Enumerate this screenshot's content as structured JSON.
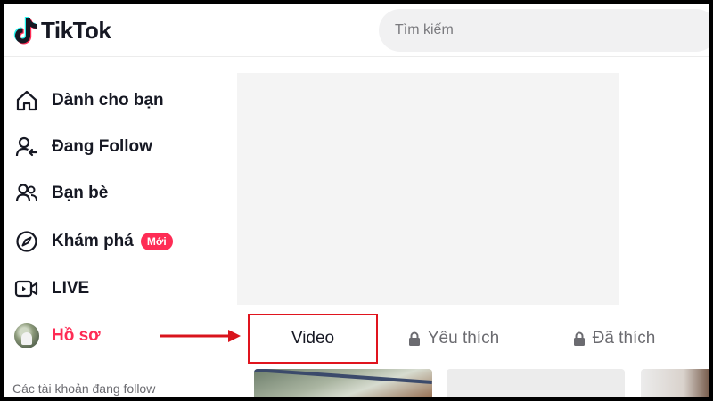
{
  "header": {
    "logo_text": "TikTok",
    "search": {
      "placeholder": "Tìm kiếm"
    }
  },
  "sidebar": {
    "items": [
      {
        "label": "Dành cho bạn",
        "icon": "home-icon"
      },
      {
        "label": "Đang Follow",
        "icon": "user-follow-icon"
      },
      {
        "label": "Bạn bè",
        "icon": "friends-icon"
      },
      {
        "label": "Khám phá",
        "icon": "compass-icon",
        "badge": "Mới"
      },
      {
        "label": "LIVE",
        "icon": "live-icon"
      },
      {
        "label": "Hồ sơ",
        "icon": "avatar",
        "active": true
      }
    ],
    "following_title": "Các tài khoản đang follow"
  },
  "profile_tabs": [
    {
      "label": "Video",
      "locked": false,
      "highlighted": true
    },
    {
      "label": "Yêu thích",
      "locked": true
    },
    {
      "label": "Đã thích",
      "locked": true
    }
  ],
  "colors": {
    "brand_red": "#fe2c55",
    "highlight_box": "#e0141e",
    "text_primary": "#161823",
    "text_secondary": "#6b6b70"
  }
}
